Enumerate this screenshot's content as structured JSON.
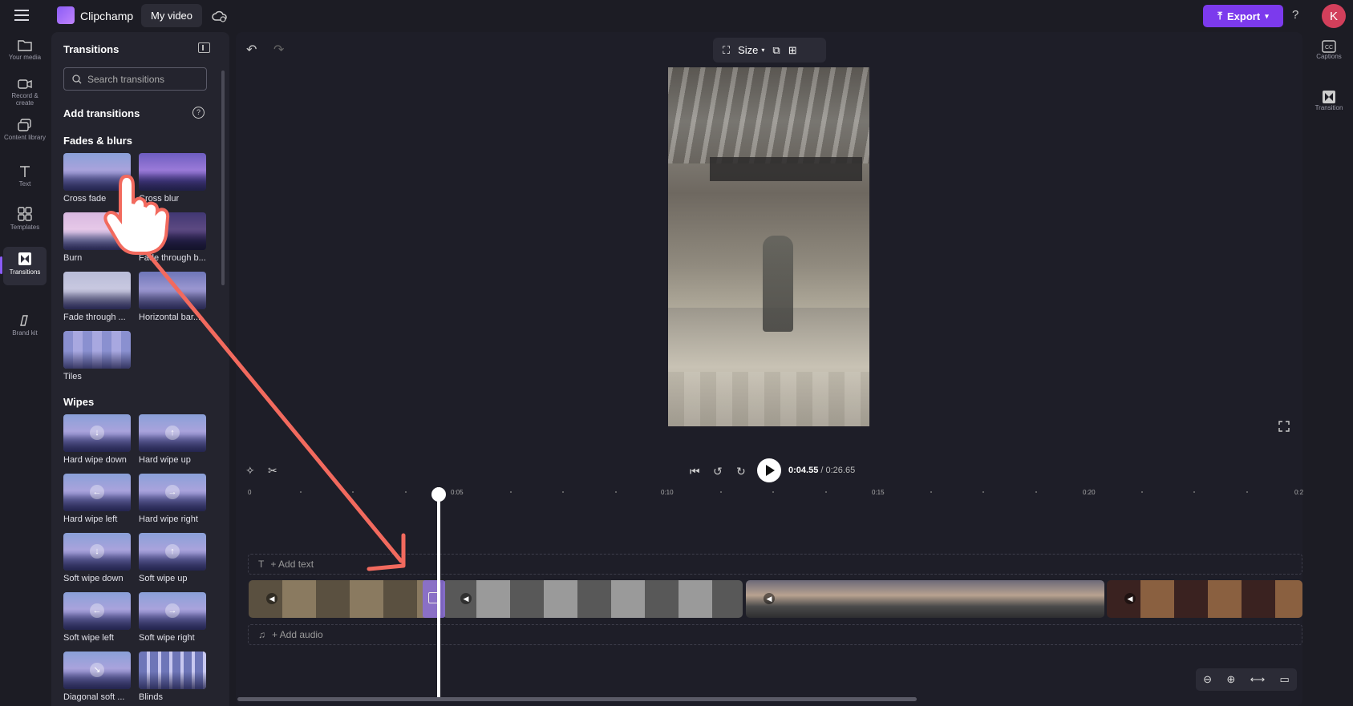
{
  "header": {
    "app_name": "Clipchamp",
    "project_name": "My video",
    "export_label": "Export",
    "help_label": "?",
    "avatar_letter": "K",
    "accent_color": "#7c3aed"
  },
  "left_nav": [
    {
      "label": "Your media",
      "icon": "folder-icon"
    },
    {
      "label": "Record & create",
      "icon": "camera-icon"
    },
    {
      "label": "Content library",
      "icon": "library-icon"
    },
    {
      "label": "Text",
      "icon": "text-icon"
    },
    {
      "label": "Templates",
      "icon": "templates-icon"
    },
    {
      "label": "Transitions",
      "icon": "transitions-icon",
      "active": true
    },
    {
      "label": "Brand kit",
      "icon": "brand-icon"
    }
  ],
  "panel": {
    "title": "Transitions",
    "search_placeholder": "Search transitions",
    "add_heading": "Add transitions",
    "sections": [
      {
        "title": "Fades & blurs",
        "items": [
          "Cross fade",
          "Cross blur",
          "Burn",
          "Fade through b...",
          "Fade through ...",
          "Horizontal bar...",
          "Tiles"
        ]
      },
      {
        "title": "Wipes",
        "items": [
          "Hard wipe down",
          "Hard wipe up",
          "Hard wipe left",
          "Hard wipe right",
          "Soft wipe down",
          "Soft wipe up",
          "Soft wipe left",
          "Soft wipe right",
          "Diagonal soft ...",
          "Blinds"
        ]
      }
    ]
  },
  "preview": {
    "size_label": "Size"
  },
  "playback": {
    "current_time": "0:04.55",
    "total_time": "0:26.65"
  },
  "ruler": {
    "labels": [
      "0",
      "0:05",
      "0:10",
      "0:15",
      "0:20",
      "0:2"
    ]
  },
  "timeline": {
    "add_text": "+ Add text",
    "add_audio": "+ Add audio"
  },
  "right_nav": [
    {
      "label": "Captions",
      "icon": "captions-icon"
    },
    {
      "label": "Transition",
      "icon": "transition-icon"
    }
  ]
}
